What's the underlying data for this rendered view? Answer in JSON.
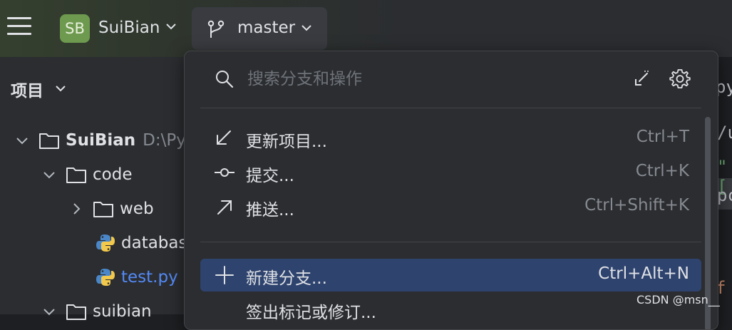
{
  "titlebar": {
    "project_badge": "SB",
    "project_name": "SuiBian",
    "branch_name": "master"
  },
  "project_panel": {
    "title": "项目",
    "tree": [
      {
        "label": "SuiBian",
        "path": "D:\\Py"
      },
      {
        "label": "code"
      },
      {
        "label": "web"
      },
      {
        "label": "databas"
      },
      {
        "label": "test.py"
      },
      {
        "label": "suibian"
      }
    ]
  },
  "editor_peek": {
    "lines": [
      "py",
      "/u",
      "\"[",
      "pc",
      "f"
    ]
  },
  "popup": {
    "search_placeholder": "搜索分支和操作",
    "actions": [
      {
        "icon": "update-arrow-icon",
        "label": "更新项目...",
        "shortcut": "Ctrl+T"
      },
      {
        "icon": "commit-icon",
        "label": "提交...",
        "shortcut": "Ctrl+K"
      },
      {
        "icon": "push-arrow-icon",
        "label": "推送...",
        "shortcut": "Ctrl+Shift+K"
      },
      {
        "icon": "plus-icon",
        "label": "新建分支...",
        "shortcut": "Ctrl+Alt+N",
        "selected": true
      },
      {
        "label": "签出标记或修订..."
      }
    ]
  },
  "colors": {
    "accent_selected": "#2e436e",
    "badge_green": "#6e9a4f",
    "file_blue": "#548af7"
  },
  "watermark": "CSDN @msn__"
}
